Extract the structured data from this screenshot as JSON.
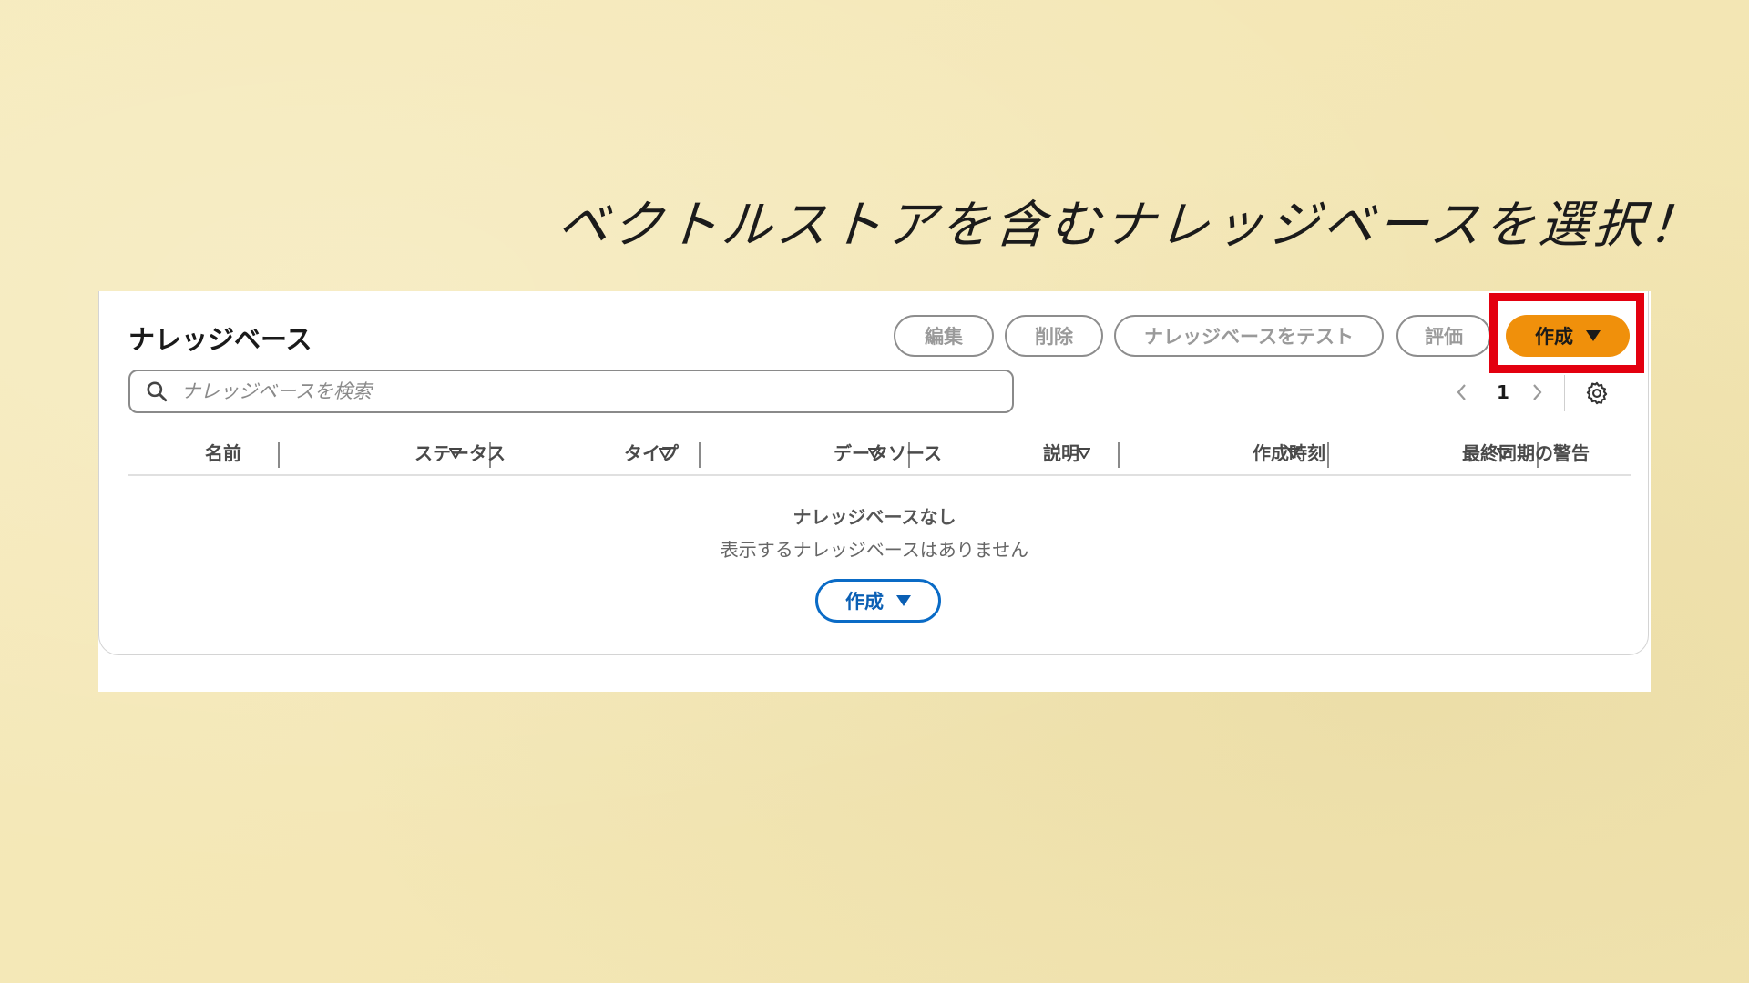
{
  "caption": "ベクトルストアを含むナレッジベースを選択！",
  "panel": {
    "title": "ナレッジベース",
    "buttons": {
      "edit": "編集",
      "delete": "削除",
      "test": "ナレッジベースをテスト",
      "evaluate": "評価",
      "create": "作成"
    },
    "search": {
      "placeholder": "ナレッジベースを検索"
    },
    "pagination": {
      "current_page": "1"
    },
    "columns": [
      "名前",
      "ステータス",
      "タイプ",
      "データソース",
      "説明",
      "作成時刻",
      "最終同期の警告"
    ],
    "empty_state": {
      "title": "ナレッジベースなし",
      "message": "表示するナレッジベースはありません",
      "create_label": "作成"
    }
  },
  "colors": {
    "background": "#f5e8b5",
    "primary_button": "#f0900b",
    "highlight": "#e3000f",
    "link_blue": "#0a5fb4"
  },
  "icons": [
    "search-icon",
    "chevron-left-icon",
    "chevron-right-icon",
    "gear-icon",
    "sort-icon",
    "caret-down-icon"
  ]
}
